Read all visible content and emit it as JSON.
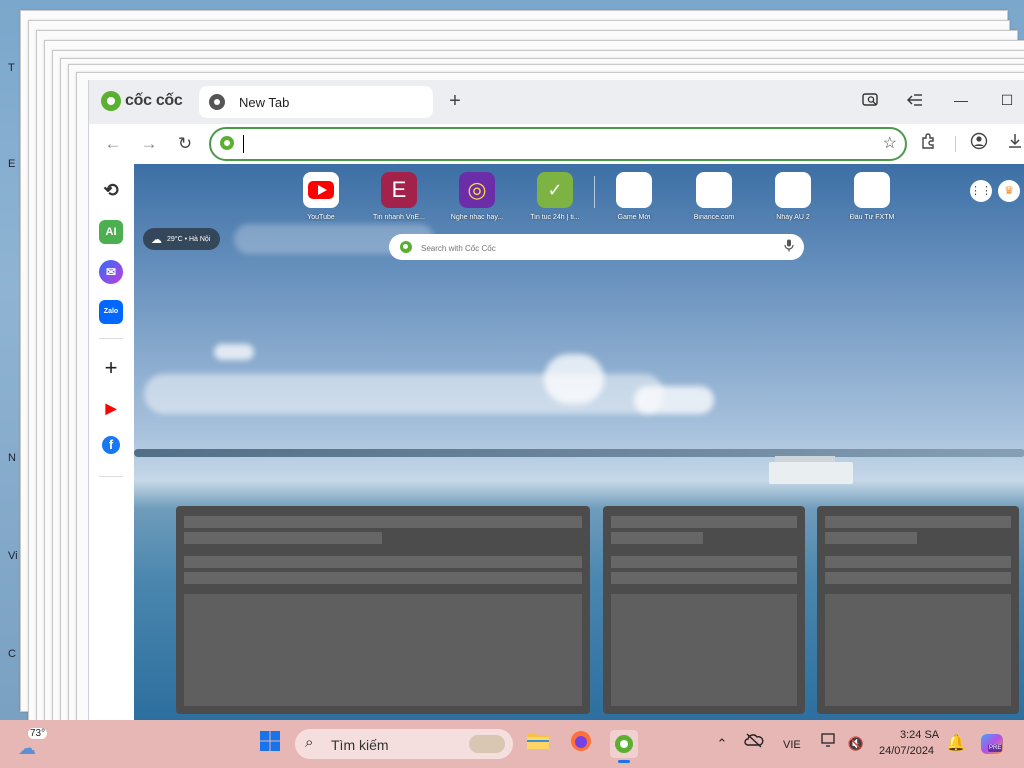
{
  "desktop": {
    "edge_letters": [
      "T",
      "E",
      "N",
      "Vi",
      "C"
    ]
  },
  "browser": {
    "brand": "cốc cốc",
    "tab": {
      "title": "New Tab"
    },
    "new_tab_symbol": "+",
    "omnibox": {
      "value": "",
      "placeholder": ""
    },
    "window_controls": {
      "minimize": "—",
      "maximize": "☐"
    },
    "sidebar": {
      "items": [
        {
          "name": "history",
          "symbol": "⟲"
        },
        {
          "name": "ai",
          "symbol": "AI"
        },
        {
          "name": "messenger",
          "symbol": "✉"
        },
        {
          "name": "zalo",
          "symbol": "Zalo"
        },
        {
          "name": "add",
          "symbol": "+"
        },
        {
          "name": "youtube",
          "symbol": "▶"
        },
        {
          "name": "facebook",
          "symbol": "f"
        }
      ]
    },
    "newtab": {
      "weather": "29°C • Hà Nội",
      "search_placeholder": "Search with Cốc Cốc",
      "shortcuts": [
        {
          "label": "YouTube",
          "color": "#ff0000",
          "glyph": "▶"
        },
        {
          "label": "Tin nhanh VnE...",
          "color": "#a3224b",
          "glyph": "E"
        },
        {
          "label": "Nghe nhạc hay...",
          "color": "#6b2ea8",
          "glyph": "◎"
        },
        {
          "label": "Tin tuc 24h | ti...",
          "color": "#7cb342",
          "glyph": "✓"
        },
        {
          "label": "Game Mới",
          "color": "#ffffff",
          "glyph": ""
        },
        {
          "label": "Binance.com",
          "color": "#ffffff",
          "glyph": ""
        },
        {
          "label": "Nhảy AU 2",
          "color": "#ffffff",
          "glyph": ""
        },
        {
          "label": "Đầu Tư FXTM",
          "color": "#ffffff",
          "glyph": ""
        }
      ]
    }
  },
  "taskbar": {
    "weather_temp": "73°",
    "search_label": "Tìm kiếm",
    "language": "VIE",
    "time": "3:24 SA",
    "date": "24/07/2024",
    "pre_badge": "PRE"
  }
}
